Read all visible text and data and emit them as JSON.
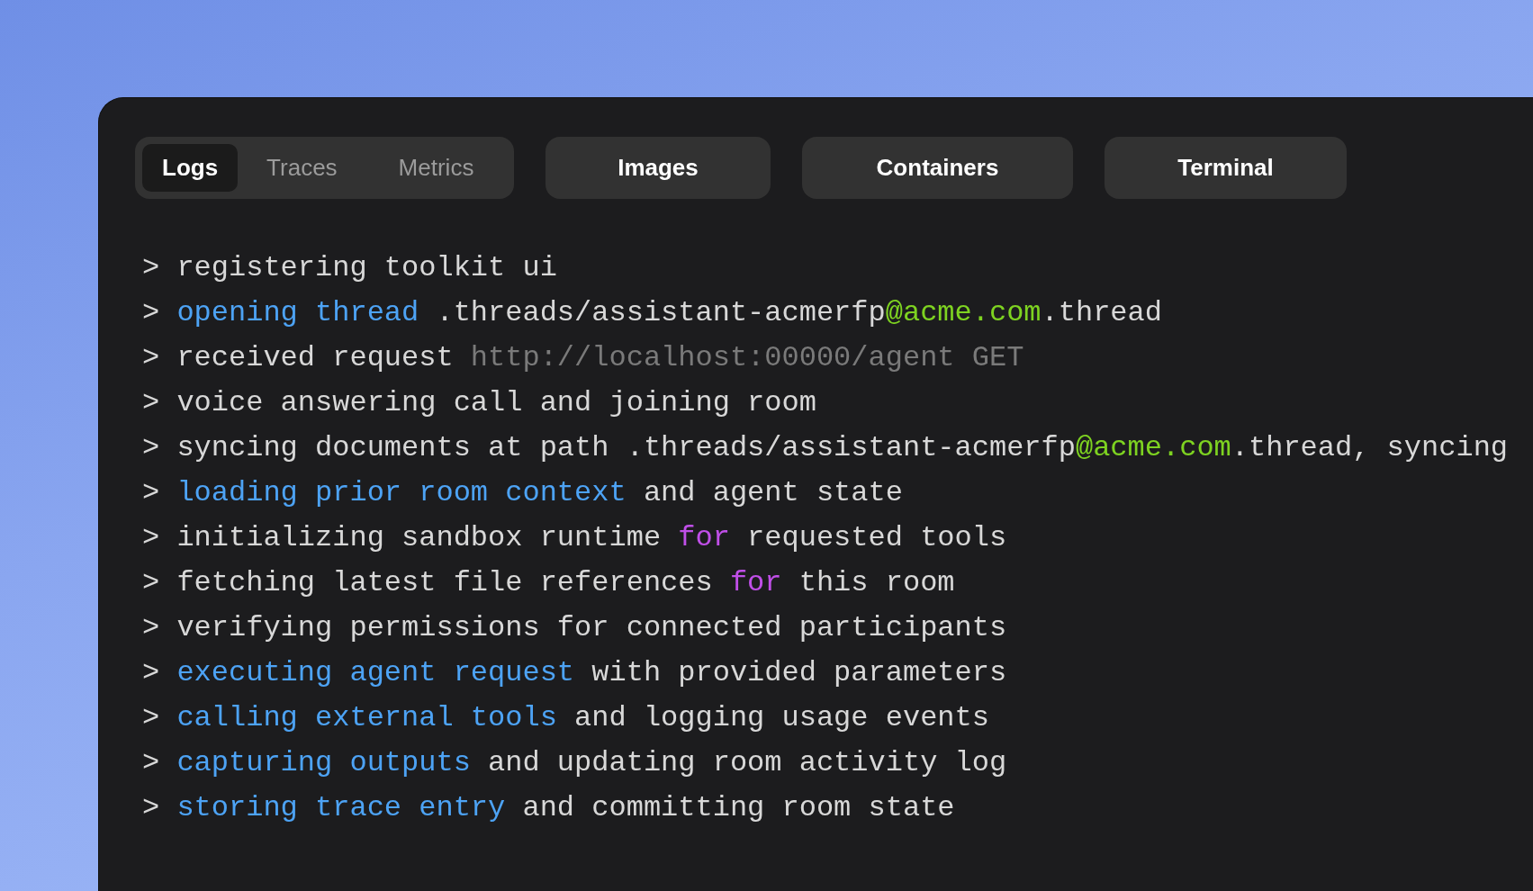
{
  "tabs": [
    {
      "label": "Logs",
      "selected": true
    },
    {
      "label": "Traces",
      "selected": false
    },
    {
      "label": "Metrics",
      "selected": false
    }
  ],
  "buttons": [
    "Images",
    "Containers",
    "Terminal"
  ],
  "log_lines": [
    {
      "prompt": ">",
      "segments": [
        {
          "kind": "plain",
          "text": "registering toolkit ui"
        }
      ]
    },
    {
      "prompt": ">",
      "segments": [
        {
          "kind": "action",
          "text": "opening thread"
        },
        {
          "kind": "plain",
          "text": " .threads/assistant-acmerfp"
        },
        {
          "kind": "email",
          "text": "@acme.com"
        },
        {
          "kind": "plain",
          "text": ".thread"
        }
      ]
    },
    {
      "prompt": ">",
      "segments": [
        {
          "kind": "plain",
          "text": "received request "
        },
        {
          "kind": "url",
          "text": "http://localhost:00000/agent GET"
        }
      ]
    },
    {
      "prompt": ">",
      "segments": [
        {
          "kind": "plain",
          "text": "voice answering call and joining room"
        }
      ]
    },
    {
      "prompt": ">",
      "segments": [
        {
          "kind": "plain",
          "text": "syncing documents at path .threads/assistant-acmerfp"
        },
        {
          "kind": "email",
          "text": "@acme.com"
        },
        {
          "kind": "plain",
          "text": ".thread, syncing"
        }
      ]
    },
    {
      "prompt": ">",
      "segments": [
        {
          "kind": "action",
          "text": "loading prior room context"
        },
        {
          "kind": "plain",
          "text": " and agent state"
        }
      ]
    },
    {
      "prompt": ">",
      "segments": [
        {
          "kind": "plain",
          "text": "initializing sandbox runtime "
        },
        {
          "kind": "keyword",
          "text": "for"
        },
        {
          "kind": "plain",
          "text": " requested tools"
        }
      ]
    },
    {
      "prompt": ">",
      "segments": [
        {
          "kind": "plain",
          "text": "fetching latest file references "
        },
        {
          "kind": "keyword",
          "text": "for"
        },
        {
          "kind": "plain",
          "text": " this room"
        }
      ]
    },
    {
      "prompt": ">",
      "segments": [
        {
          "kind": "plain",
          "text": "verifying permissions for connected participants"
        }
      ]
    },
    {
      "prompt": ">",
      "segments": [
        {
          "kind": "action",
          "text": "executing agent request"
        },
        {
          "kind": "plain",
          "text": " with provided parameters"
        }
      ]
    },
    {
      "prompt": ">",
      "segments": [
        {
          "kind": "action",
          "text": "calling external tools"
        },
        {
          "kind": "plain",
          "text": " and logging usage events"
        }
      ]
    },
    {
      "prompt": ">",
      "segments": [
        {
          "kind": "action",
          "text": "capturing outputs"
        },
        {
          "kind": "plain",
          "text": " and updating room activity log"
        }
      ]
    },
    {
      "prompt": ">",
      "segments": [
        {
          "kind": "action",
          "text": "storing trace entry"
        },
        {
          "kind": "plain",
          "text": " and committing room state"
        }
      ]
    }
  ]
}
